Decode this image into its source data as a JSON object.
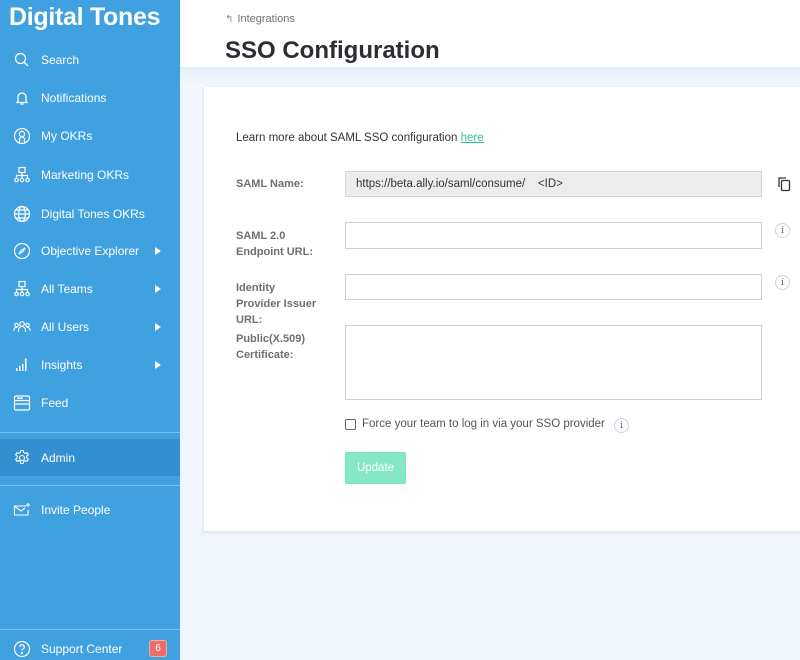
{
  "sidebar": {
    "brand": "Digital Tones",
    "items": [
      {
        "label": "Search",
        "icon": "search-icon"
      },
      {
        "label": "Notifications",
        "icon": "bell-icon"
      },
      {
        "label": "My OKRs",
        "icon": "user-circle-icon"
      },
      {
        "label": "Marketing OKRs",
        "icon": "org-chart-icon"
      },
      {
        "label": "Digital Tones OKRs",
        "icon": "globe-icon"
      },
      {
        "label": "Objective Explorer",
        "icon": "compass-icon",
        "has_submenu": true
      },
      {
        "label": "All Teams",
        "icon": "org-chart-icon",
        "has_submenu": true
      },
      {
        "label": "All Users",
        "icon": "users-icon",
        "has_submenu": true
      },
      {
        "label": "Insights",
        "icon": "bar-chart-icon",
        "has_submenu": true
      },
      {
        "label": "Feed",
        "icon": "feed-icon"
      }
    ],
    "admin": {
      "label": "Admin",
      "icon": "gear-icon",
      "active": true
    },
    "invite": {
      "label": "Invite People",
      "icon": "mail-plus-icon"
    },
    "support": {
      "label": "Support Center",
      "icon": "help-circle-icon",
      "badge": "6"
    }
  },
  "header": {
    "breadcrumb": "Integrations",
    "title": "SSO Configuration"
  },
  "form": {
    "learn_text": "Learn more about SAML SSO configuration ",
    "learn_link": "here",
    "saml_name": {
      "label": "SAML Name:",
      "value": "https://beta.ally.io/saml/consume/    <ID>"
    },
    "endpoint": {
      "label_line1": "SAML 2.0",
      "label_line2": "Endpoint URL:",
      "value": ""
    },
    "issuer": {
      "label_line1": "Identity",
      "label_line2": "Provider Issuer",
      "label_line3": "URL:",
      "value": ""
    },
    "certificate": {
      "label_line1": "Public(X.509)",
      "label_line2": "Certificate:",
      "value": ""
    },
    "force_sso": {
      "label": "Force your team to log in via your SSO provider",
      "checked": false
    },
    "update_label": "Update"
  },
  "colors": {
    "sidebar_bg": "#3fa1e0",
    "sidebar_active": "#3390d0",
    "accent_green": "#2fc08a",
    "button_green": "#85e8c4",
    "badge_red": "#ef6a6a"
  }
}
